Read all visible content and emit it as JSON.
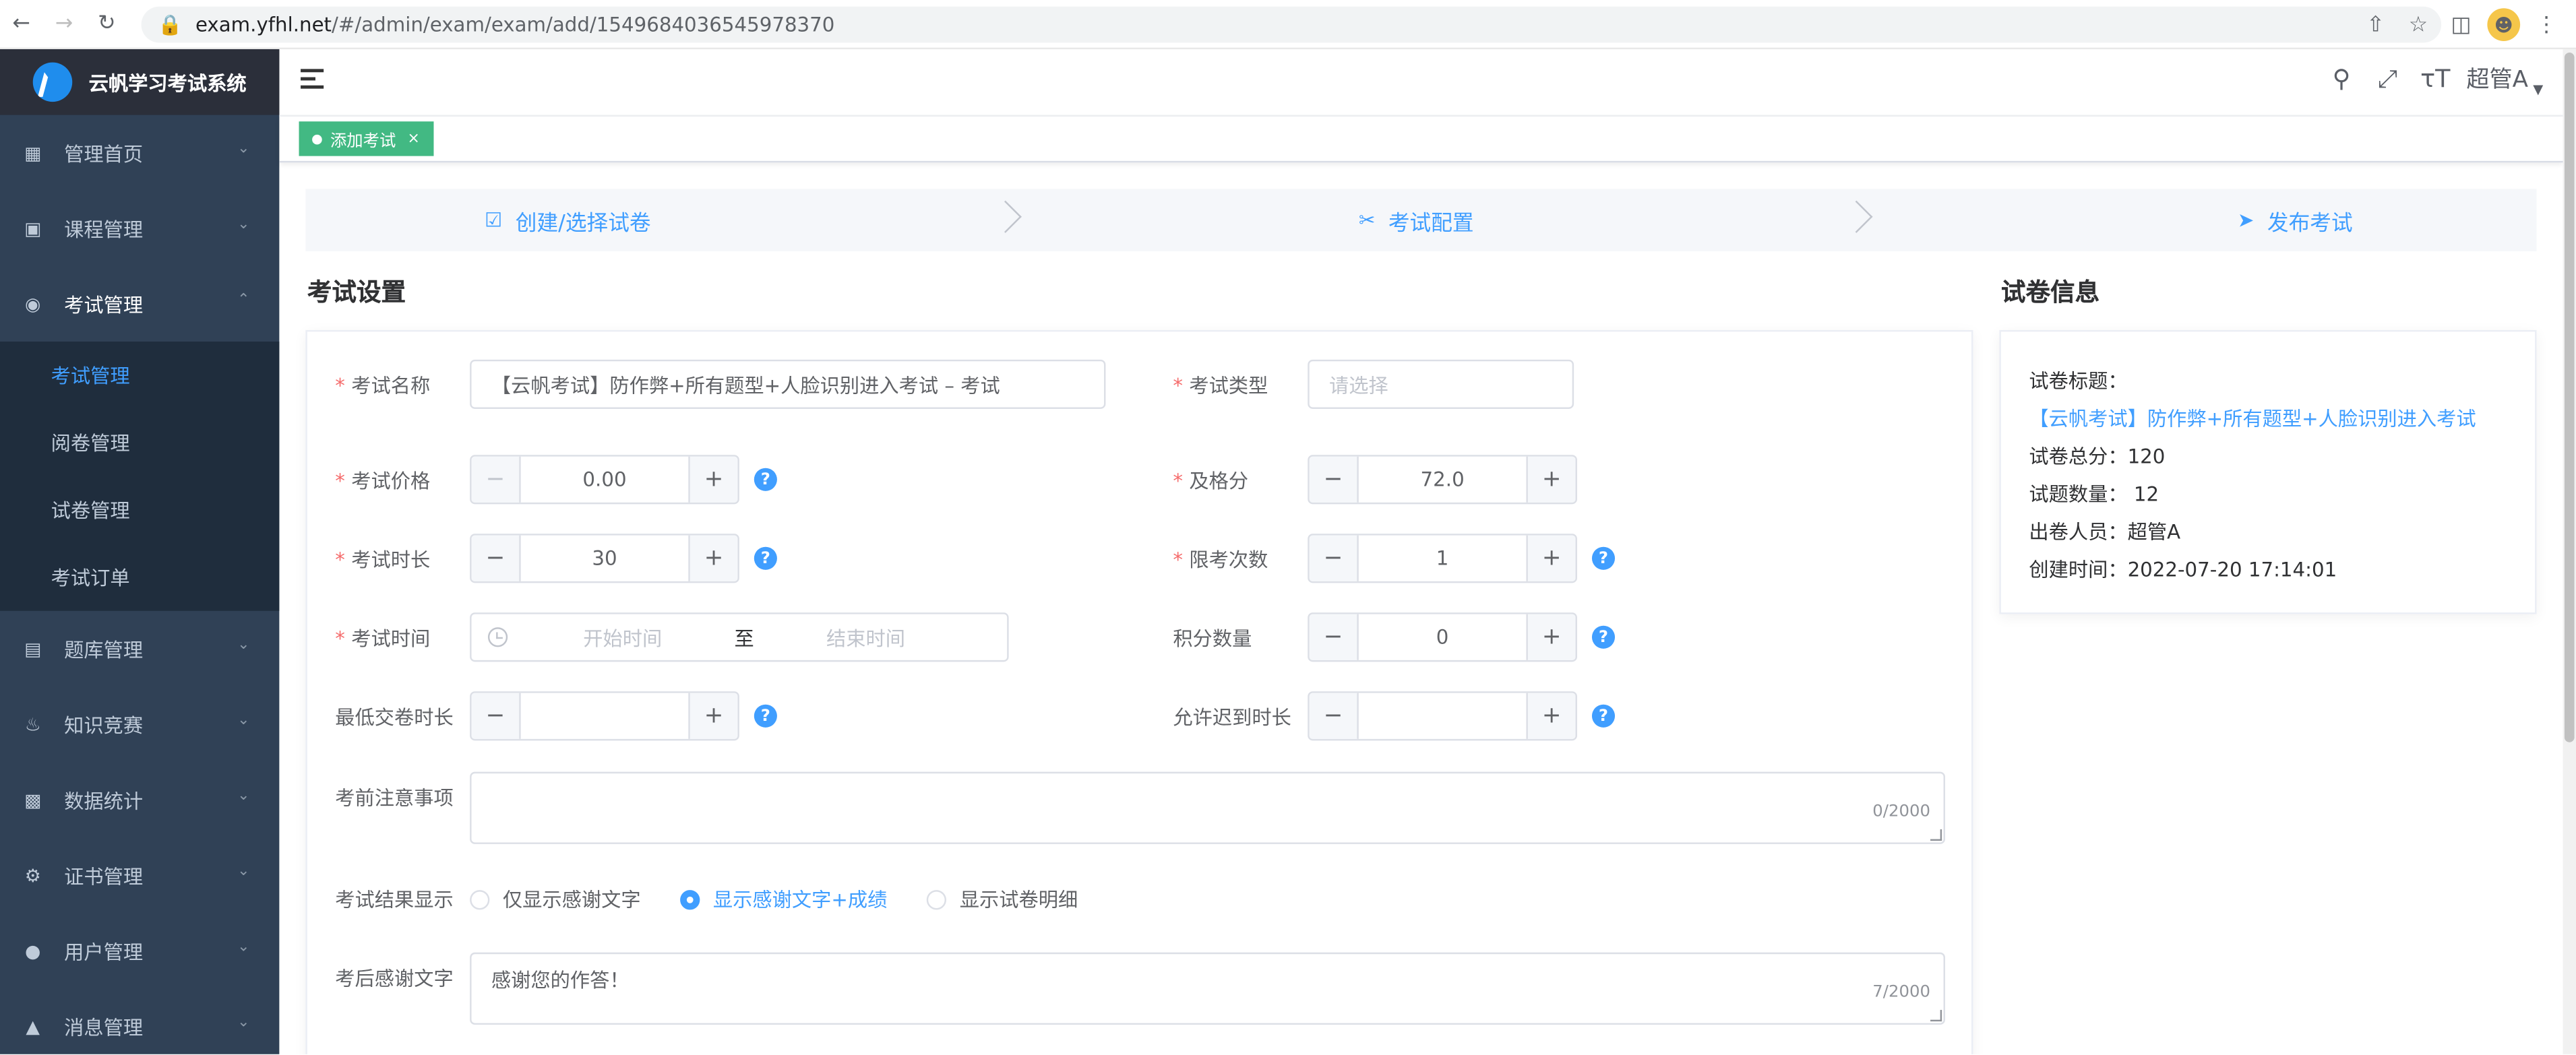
{
  "browser": {
    "url_host": "exam.yfhl.net",
    "url_path": "/#/admin/exam/exam/add/1549684036545978370"
  },
  "app": {
    "title": "云帆学习考试系统"
  },
  "sidebar": {
    "items": [
      {
        "label": "管理首页",
        "icon": "dashboard-icon"
      },
      {
        "label": "课程管理",
        "icon": "course-icon"
      },
      {
        "label": "考试管理",
        "icon": "exam-icon",
        "open": true,
        "children": [
          {
            "label": "考试管理",
            "active": true
          },
          {
            "label": "阅卷管理"
          },
          {
            "label": "试卷管理"
          },
          {
            "label": "考试订单"
          }
        ]
      },
      {
        "label": "题库管理",
        "icon": "question-bank-icon"
      },
      {
        "label": "知识竞赛",
        "icon": "fire-icon"
      },
      {
        "label": "数据统计",
        "icon": "bar-chart-icon"
      },
      {
        "label": "证书管理",
        "icon": "gear-icon"
      },
      {
        "label": "用户管理",
        "icon": "user-icon"
      },
      {
        "label": "消息管理",
        "icon": "bell-icon"
      }
    ]
  },
  "header": {
    "user_name": "超管A"
  },
  "tags": [
    {
      "label": "添加考试"
    }
  ],
  "steps": [
    {
      "label": "创建/选择试卷",
      "icon": "clipboard-check-icon"
    },
    {
      "label": "考试配置",
      "icon": "ticket-icon"
    },
    {
      "label": "发布考试",
      "icon": "send-icon"
    }
  ],
  "form": {
    "section_title": "考试设置",
    "exam_name": {
      "label": "考试名称",
      "value": "【云帆考试】防作弊+所有题型+人脸识别进入考试 – 考试"
    },
    "exam_type": {
      "label": "考试类型",
      "placeholder": "请选择"
    },
    "price": {
      "label": "考试价格",
      "value": "0.00"
    },
    "pass_score": {
      "label": "及格分",
      "value": "72.0"
    },
    "duration": {
      "label": "考试时长",
      "value": "30"
    },
    "attempts": {
      "label": "限考次数",
      "value": "1"
    },
    "exam_time": {
      "label": "考试时间",
      "start_placeholder": "开始时间",
      "separator": "至",
      "end_placeholder": "结束时间"
    },
    "points": {
      "label": "积分数量",
      "value": "0"
    },
    "min_submit": {
      "label": "最低交卷时长",
      "value": ""
    },
    "late_allow": {
      "label": "允许迟到时长",
      "value": ""
    },
    "notice": {
      "label": "考前注意事项",
      "value": "",
      "counter": "0/2000"
    },
    "result_display": {
      "label": "考试结果显示",
      "options": [
        {
          "label": "仅显示感谢文字",
          "checked": false
        },
        {
          "label": "显示感谢文字+成绩",
          "checked": true
        },
        {
          "label": "显示试卷明细",
          "checked": false
        }
      ]
    },
    "thanks": {
      "label": "考后感谢文字",
      "value": "感谢您的作答！",
      "counter": "7/2000"
    }
  },
  "paper_info": {
    "section_title": "试卷信息",
    "title_label": "试卷标题：",
    "title_value": "【云帆考试】防作弊+所有题型+人脸识别进入考试",
    "total_score": "试卷总分：120",
    "question_count": "试题数量： 12",
    "author": "出卷人员：超管A",
    "created": "创建时间：2022-07-20 17:14:01"
  },
  "colors": {
    "sidebar_bg": "#304156",
    "accent": "#409eff",
    "tag_green": "#42b983",
    "required": "#f56c6c"
  }
}
